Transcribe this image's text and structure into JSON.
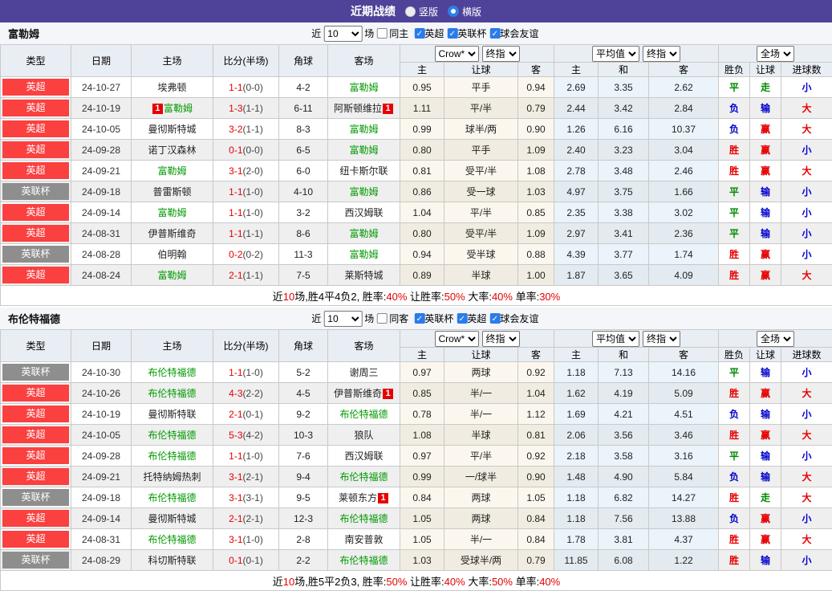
{
  "topbar": {
    "title": "近期战绩",
    "radios": [
      {
        "label": "竖版",
        "selected": false
      },
      {
        "label": "横版",
        "selected": true
      }
    ]
  },
  "colors": {
    "topbar_bg": "#4e4399",
    "team_green": "#009900",
    "score_red": "#e60000",
    "accent_red": "#e60000",
    "league": {
      "英超": "#fb4040",
      "英联杯": "#8e8e8e"
    },
    "result": {
      "胜": "#e60000",
      "平": "#008800",
      "负": "#0000cd",
      "赢": "#e60000",
      "走": "#008800",
      "输": "#0000cd",
      "大": "#e60000",
      "小": "#0000cd"
    }
  },
  "columns": {
    "type": "类型",
    "date": "日期",
    "home": "主场",
    "score": "比分(半场)",
    "corner": "角球",
    "away": "客场",
    "h": "主",
    "handicap": "让球",
    "a": "客",
    "h2": "主",
    "d": "和",
    "a2": "客",
    "result": "胜负",
    "handicap_result": "让球",
    "goals": "进球数"
  },
  "selects": {
    "company": "Crow*",
    "company_stage": "终指",
    "avg": "平均值",
    "avg_stage": "终指",
    "scope": "全场"
  },
  "sections": [
    {
      "team": "富勒姆",
      "filter": {
        "near_label": "近",
        "count": "10",
        "games_label": "场",
        "same_label": "同主",
        "same_checked": false,
        "leagues": [
          {
            "label": "英超",
            "checked": true
          },
          {
            "label": "英联杯",
            "checked": true
          },
          {
            "label": "球会友谊",
            "checked": true
          }
        ]
      },
      "rows": [
        {
          "league": "英超",
          "date": "24-10-27",
          "home": {
            "name": "埃弗顿"
          },
          "score": "1-1",
          "half": "(0-0)",
          "corner": "4-2",
          "away": {
            "name": "富勒姆",
            "focal": true
          },
          "h": "0.95",
          "hc": "平手",
          "a": "0.94",
          "ah": "2.69",
          "ad": "3.35",
          "aa": "2.62",
          "r1": "平",
          "r2": "走",
          "r3": "小"
        },
        {
          "league": "英超",
          "date": "24-10-19",
          "home": {
            "name": "富勒姆",
            "focal": true,
            "card": "1",
            "cardPos": "before"
          },
          "score": "1-3",
          "half": "(1-1)",
          "corner": "6-11",
          "away": {
            "name": "阿斯顿维拉",
            "card": "1",
            "cardPos": "after"
          },
          "h": "1.11",
          "hc": "平/半",
          "a": "0.79",
          "ah": "2.44",
          "ad": "3.42",
          "aa": "2.84",
          "r1": "负",
          "r2": "输",
          "r3": "大"
        },
        {
          "league": "英超",
          "date": "24-10-05",
          "home": {
            "name": "曼彻斯特城"
          },
          "score": "3-2",
          "half": "(1-1)",
          "corner": "8-3",
          "away": {
            "name": "富勒姆",
            "focal": true
          },
          "h": "0.99",
          "hc": "球半/两",
          "a": "0.90",
          "ah": "1.26",
          "ad": "6.16",
          "aa": "10.37",
          "r1": "负",
          "r2": "赢",
          "r3": "大"
        },
        {
          "league": "英超",
          "date": "24-09-28",
          "home": {
            "name": "诺丁汉森林"
          },
          "score": "0-1",
          "half": "(0-0)",
          "corner": "6-5",
          "away": {
            "name": "富勒姆",
            "focal": true
          },
          "h": "0.80",
          "hc": "平手",
          "a": "1.09",
          "ah": "2.40",
          "ad": "3.23",
          "aa": "3.04",
          "r1": "胜",
          "r2": "赢",
          "r3": "小"
        },
        {
          "league": "英超",
          "date": "24-09-21",
          "home": {
            "name": "富勒姆",
            "focal": true
          },
          "score": "3-1",
          "half": "(2-0)",
          "corner": "6-0",
          "away": {
            "name": "纽卡斯尔联"
          },
          "h": "0.81",
          "hc": "受平/半",
          "a": "1.08",
          "ah": "2.78",
          "ad": "3.48",
          "aa": "2.46",
          "r1": "胜",
          "r2": "赢",
          "r3": "大"
        },
        {
          "league": "英联杯",
          "date": "24-09-18",
          "home": {
            "name": "普雷斯顿"
          },
          "score": "1-1",
          "half": "(1-0)",
          "corner": "4-10",
          "away": {
            "name": "富勒姆",
            "focal": true
          },
          "h": "0.86",
          "hc": "受一球",
          "a": "1.03",
          "ah": "4.97",
          "ad": "3.75",
          "aa": "1.66",
          "r1": "平",
          "r2": "输",
          "r3": "小"
        },
        {
          "league": "英超",
          "date": "24-09-14",
          "home": {
            "name": "富勒姆",
            "focal": true
          },
          "score": "1-1",
          "half": "(1-0)",
          "corner": "3-2",
          "away": {
            "name": "西汉姆联"
          },
          "h": "1.04",
          "hc": "平/半",
          "a": "0.85",
          "ah": "2.35",
          "ad": "3.38",
          "aa": "3.02",
          "r1": "平",
          "r2": "输",
          "r3": "小"
        },
        {
          "league": "英超",
          "date": "24-08-31",
          "home": {
            "name": "伊普斯维奇"
          },
          "score": "1-1",
          "half": "(1-1)",
          "corner": "8-6",
          "away": {
            "name": "富勒姆",
            "focal": true
          },
          "h": "0.80",
          "hc": "受平/半",
          "a": "1.09",
          "ah": "2.97",
          "ad": "3.41",
          "aa": "2.36",
          "r1": "平",
          "r2": "输",
          "r3": "小"
        },
        {
          "league": "英联杯",
          "date": "24-08-28",
          "home": {
            "name": "伯明翰"
          },
          "score": "0-2",
          "half": "(0-2)",
          "corner": "11-3",
          "away": {
            "name": "富勒姆",
            "focal": true
          },
          "h": "0.94",
          "hc": "受半球",
          "a": "0.88",
          "ah": "4.39",
          "ad": "3.77",
          "aa": "1.74",
          "r1": "胜",
          "r2": "赢",
          "r3": "小"
        },
        {
          "league": "英超",
          "date": "24-08-24",
          "home": {
            "name": "富勒姆",
            "focal": true
          },
          "score": "2-1",
          "half": "(1-1)",
          "corner": "7-5",
          "away": {
            "name": "莱斯特城"
          },
          "h": "0.89",
          "hc": "半球",
          "a": "1.00",
          "ah": "1.87",
          "ad": "3.65",
          "aa": "4.09",
          "r1": "胜",
          "r2": "赢",
          "r3": "大"
        }
      ],
      "summary": [
        {
          "t": "近",
          "c": "k"
        },
        {
          "t": "10",
          "c": "r"
        },
        {
          "t": "场,胜4平4负2, 胜率:",
          "c": "k"
        },
        {
          "t": "40%",
          "c": "r"
        },
        {
          "t": " 让胜率:",
          "c": "k"
        },
        {
          "t": "50%",
          "c": "r"
        },
        {
          "t": " 大率:",
          "c": "k"
        },
        {
          "t": "40%",
          "c": "r"
        },
        {
          "t": " 单率:",
          "c": "k"
        },
        {
          "t": "30%",
          "c": "r"
        }
      ]
    },
    {
      "team": "布伦特福德",
      "filter": {
        "near_label": "近",
        "count": "10",
        "games_label": "场",
        "same_label": "同客",
        "same_checked": false,
        "leagues": [
          {
            "label": "英联杯",
            "checked": true
          },
          {
            "label": "英超",
            "checked": true
          },
          {
            "label": "球会友谊",
            "checked": true
          }
        ]
      },
      "rows": [
        {
          "league": "英联杯",
          "date": "24-10-30",
          "home": {
            "name": "布伦特福德",
            "focal": true
          },
          "score": "1-1",
          "half": "(1-0)",
          "corner": "5-2",
          "away": {
            "name": "谢周三"
          },
          "h": "0.97",
          "hc": "两球",
          "a": "0.92",
          "ah": "1.18",
          "ad": "7.13",
          "aa": "14.16",
          "r1": "平",
          "r2": "输",
          "r3": "小"
        },
        {
          "league": "英超",
          "date": "24-10-26",
          "home": {
            "name": "布伦特福德",
            "focal": true
          },
          "score": "4-3",
          "half": "(2-2)",
          "corner": "4-5",
          "away": {
            "name": "伊普斯维奇",
            "card": "1",
            "cardPos": "after"
          },
          "h": "0.85",
          "hc": "半/一",
          "a": "1.04",
          "ah": "1.62",
          "ad": "4.19",
          "aa": "5.09",
          "r1": "胜",
          "r2": "赢",
          "r3": "大"
        },
        {
          "league": "英超",
          "date": "24-10-19",
          "home": {
            "name": "曼彻斯特联"
          },
          "score": "2-1",
          "half": "(0-1)",
          "corner": "9-2",
          "away": {
            "name": "布伦特福德",
            "focal": true
          },
          "h": "0.78",
          "hc": "半/一",
          "a": "1.12",
          "ah": "1.69",
          "ad": "4.21",
          "aa": "4.51",
          "r1": "负",
          "r2": "输",
          "r3": "小"
        },
        {
          "league": "英超",
          "date": "24-10-05",
          "home": {
            "name": "布伦特福德",
            "focal": true
          },
          "score": "5-3",
          "half": "(4-2)",
          "corner": "10-3",
          "away": {
            "name": "狼队"
          },
          "h": "1.08",
          "hc": "半球",
          "a": "0.81",
          "ah": "2.06",
          "ad": "3.56",
          "aa": "3.46",
          "r1": "胜",
          "r2": "赢",
          "r3": "大"
        },
        {
          "league": "英超",
          "date": "24-09-28",
          "home": {
            "name": "布伦特福德",
            "focal": true
          },
          "score": "1-1",
          "half": "(1-0)",
          "corner": "7-6",
          "away": {
            "name": "西汉姆联"
          },
          "h": "0.97",
          "hc": "平/半",
          "a": "0.92",
          "ah": "2.18",
          "ad": "3.58",
          "aa": "3.16",
          "r1": "平",
          "r2": "输",
          "r3": "小"
        },
        {
          "league": "英超",
          "date": "24-09-21",
          "home": {
            "name": "托特纳姆热刺"
          },
          "score": "3-1",
          "half": "(2-1)",
          "corner": "9-4",
          "away": {
            "name": "布伦特福德",
            "focal": true
          },
          "h": "0.99",
          "hc": "一/球半",
          "a": "0.90",
          "ah": "1.48",
          "ad": "4.90",
          "aa": "5.84",
          "r1": "负",
          "r2": "输",
          "r3": "大"
        },
        {
          "league": "英联杯",
          "date": "24-09-18",
          "home": {
            "name": "布伦特福德",
            "focal": true
          },
          "score": "3-1",
          "half": "(3-1)",
          "corner": "9-5",
          "away": {
            "name": "莱顿东方",
            "card": "1",
            "cardPos": "after"
          },
          "h": "0.84",
          "hc": "两球",
          "a": "1.05",
          "ah": "1.18",
          "ad": "6.82",
          "aa": "14.27",
          "r1": "胜",
          "r2": "走",
          "r3": "大"
        },
        {
          "league": "英超",
          "date": "24-09-14",
          "home": {
            "name": "曼彻斯特城"
          },
          "score": "2-1",
          "half": "(2-1)",
          "corner": "12-3",
          "away": {
            "name": "布伦特福德",
            "focal": true
          },
          "h": "1.05",
          "hc": "两球",
          "a": "0.84",
          "ah": "1.18",
          "ad": "7.56",
          "aa": "13.88",
          "r1": "负",
          "r2": "赢",
          "r3": "小"
        },
        {
          "league": "英超",
          "date": "24-08-31",
          "home": {
            "name": "布伦特福德",
            "focal": true
          },
          "score": "3-1",
          "half": "(1-0)",
          "corner": "2-8",
          "away": {
            "name": "南安普敦"
          },
          "h": "1.05",
          "hc": "半/一",
          "a": "0.84",
          "ah": "1.78",
          "ad": "3.81",
          "aa": "4.37",
          "r1": "胜",
          "r2": "赢",
          "r3": "大"
        },
        {
          "league": "英联杯",
          "date": "24-08-29",
          "home": {
            "name": "科切斯特联"
          },
          "score": "0-1",
          "half": "(0-1)",
          "corner": "2-2",
          "away": {
            "name": "布伦特福德",
            "focal": true
          },
          "h": "1.03",
          "hc": "受球半/两",
          "a": "0.79",
          "ah": "11.85",
          "ad": "6.08",
          "aa": "1.22",
          "r1": "胜",
          "r2": "输",
          "r3": "小"
        }
      ],
      "summary": [
        {
          "t": "近",
          "c": "k"
        },
        {
          "t": "10",
          "c": "r"
        },
        {
          "t": "场,胜5平2负3, 胜率:",
          "c": "k"
        },
        {
          "t": "50%",
          "c": "r"
        },
        {
          "t": " 让胜率:",
          "c": "k"
        },
        {
          "t": "40%",
          "c": "r"
        },
        {
          "t": " 大率:",
          "c": "k"
        },
        {
          "t": "50%",
          "c": "r"
        },
        {
          "t": " 单率:",
          "c": "k"
        },
        {
          "t": "40%",
          "c": "r"
        }
      ]
    }
  ]
}
